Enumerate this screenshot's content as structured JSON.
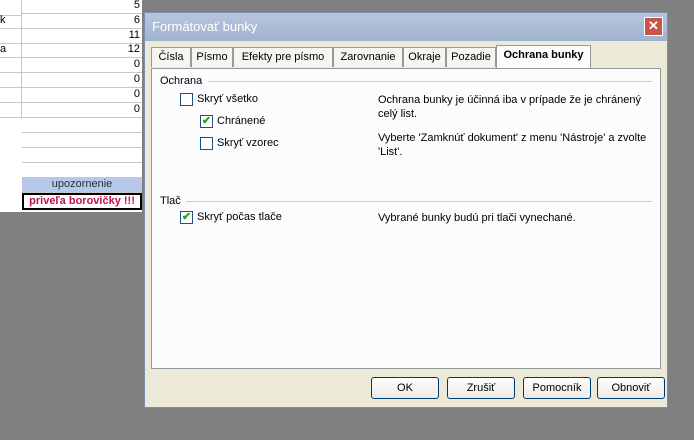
{
  "sheet": {
    "col_a": [
      "",
      "k",
      "",
      "a",
      "",
      "",
      "",
      ""
    ],
    "col_b": [
      "5",
      "6",
      "11",
      "12",
      "0",
      "0",
      "0",
      "0"
    ],
    "warning_label": "upozornenie",
    "warning_value": "priveľa borovičky !!!"
  },
  "dialog": {
    "title": "Formátovať bunky",
    "close_glyph": "✕",
    "tabs": [
      "Čísla",
      "Písmo",
      "Efekty pre písmo",
      "Zarovnanie",
      "Okraje",
      "Pozadie",
      "Ochrana bunky"
    ],
    "active_tab": "Ochrana bunky",
    "protection": {
      "heading": "Ochrana",
      "hide_all": {
        "label": "Skryť všetko",
        "checked": false
      },
      "protected": {
        "label": "Chránené",
        "checked": true
      },
      "hide_formula": {
        "label": "Skryť vzorec",
        "checked": false
      },
      "desc_1": "Ochrana bunky je účinná iba v prípade že je chránený celý list.",
      "desc_2": "Vyberte 'Zamknúť dokument' z menu 'Nástroje' a zvolte 'List'."
    },
    "print": {
      "heading": "Tlač",
      "hide_print": {
        "label": "Skryť počas tlače",
        "checked": true
      },
      "desc": "Vybrané bunky budú pri tlači vynechané."
    },
    "buttons": {
      "ok": "OK",
      "cancel": "Zrušiť",
      "help": "Pomocník",
      "reset": "Obnoviť"
    },
    "check_glyph": "✔"
  }
}
